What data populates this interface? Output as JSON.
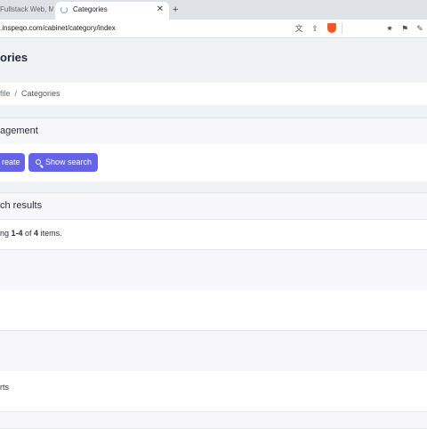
{
  "browser": {
    "tabs": [
      {
        "title": "Fullstack Web, Mob",
        "active": false
      },
      {
        "title": "Categories",
        "active": true
      }
    ],
    "new_tab_label": "+",
    "close_tab_label": "✕",
    "url": ".inspeqo.com/cabinet/category/index"
  },
  "page": {
    "title": "ories"
  },
  "breadcrumb": {
    "link": "file",
    "separator": "/",
    "current": "Categories"
  },
  "management": {
    "header": "agement",
    "create_label": "reate",
    "search_label": "Show search"
  },
  "results": {
    "header": "ch results",
    "summary_prefix": "ng ",
    "summary_range": "1-4",
    "summary_mid": " of ",
    "summary_total": "4",
    "summary_suffix": " items."
  },
  "rows": [
    {
      "label": ""
    },
    {
      "label": ""
    },
    {
      "label": ""
    },
    {
      "label": "rts"
    }
  ],
  "colors": {
    "accent": "#6563e8",
    "link": "#5b5fdc",
    "page_bg": "#f1f2f6"
  }
}
